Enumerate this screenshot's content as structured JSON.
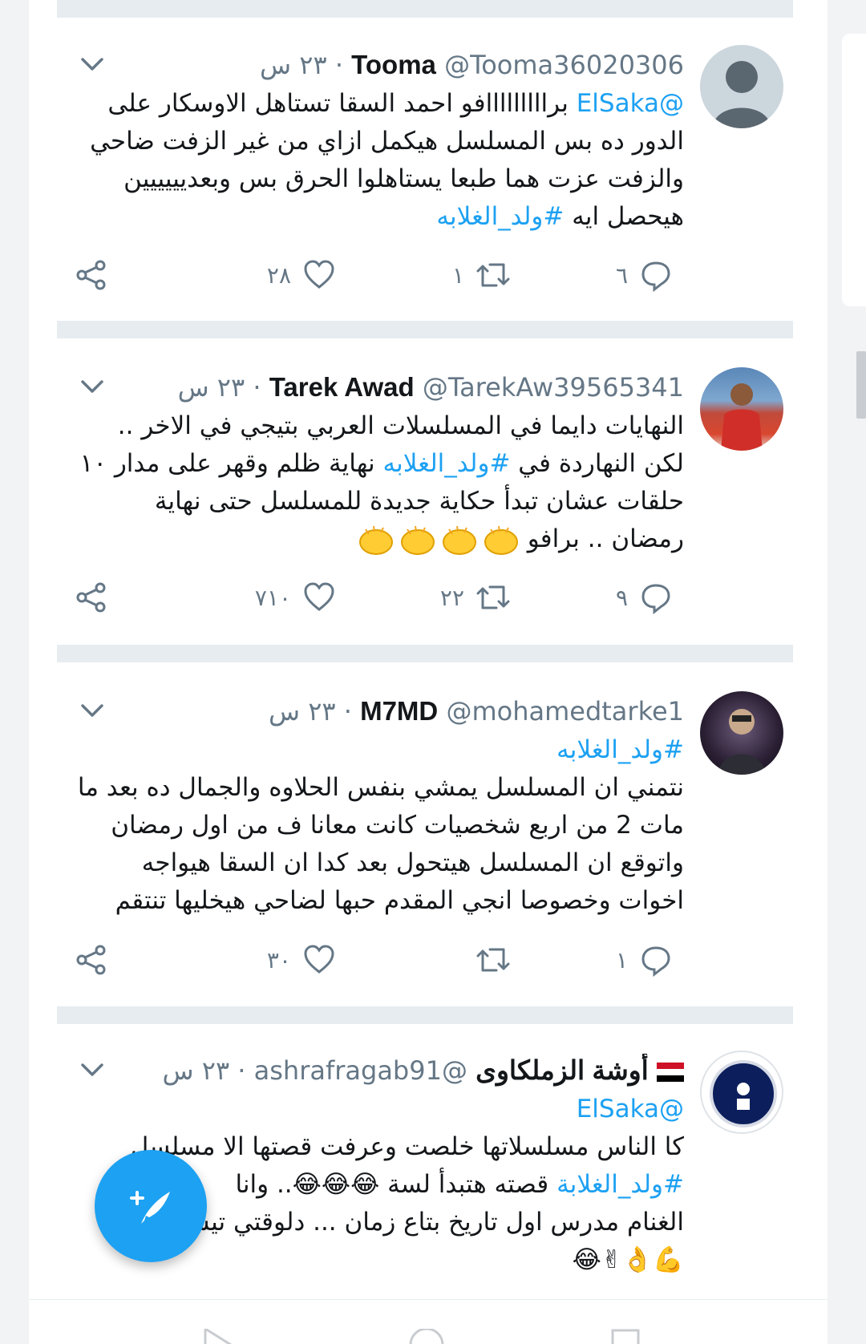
{
  "colors": {
    "accent": "#1da1f2",
    "text": "#14171a",
    "muted": "#657786",
    "separator": "#e6ecf0"
  },
  "tweets": [
    {
      "name": "Tooma",
      "handle": "@Tooma36020306",
      "time": "· ٢٣ س",
      "lines": [
        {
          "link": "@ElSaka",
          "text": " برااااااااافو احمد السقا تستاهل الاوسكار على"
        },
        {
          "text": "الدور ده بس المسلسل هيكمل ازاي من غير الزفت ضاحي"
        },
        {
          "text": "والزفت عزت هما طبعا يستاهلوا الحرق بس وبعديييييين"
        },
        {
          "text": "هيحصل ايه ",
          "link_after": "#ولد_الغلابه"
        }
      ],
      "replies": "٦",
      "retweets": "١",
      "likes": "٢٨"
    },
    {
      "name": "Tarek Awad",
      "handle": "@TarekAw39565341",
      "time": "· ٢٣ س",
      "lines": [
        {
          "text": "النهايات دايما في المسلسلات العربي بتيجي في الاخر .."
        },
        {
          "text": "لكن النهاردة في ",
          "link_after": "#ولد_الغلابه",
          "text_after": " نهاية ظلم وقهر على مدار ١٠"
        },
        {
          "text": "حلقات عشان تبدأ حكاية جديدة للمسلسل حتى نهاية"
        },
        {
          "text": "رمضان .. برافو "
        }
      ],
      "replies": "٩",
      "retweets": "٢٢",
      "likes": "٧١٠"
    },
    {
      "name": "M7MD",
      "handle": "@mohamedtarke1",
      "time": "· ٢٣ س",
      "lines": [
        {
          "link": "#ولد_الغلابه"
        },
        {
          "text": "نتمني ان المسلسل يمشي بنفس الحلاوه والجمال ده بعد ما"
        },
        {
          "text": "مات 2 من اربع شخصيات كانت معانا ف من اول رمضان"
        },
        {
          "text": "واتوقع ان المسلسل هيتحول بعد كدا ان السقا هيواجه"
        },
        {
          "text": "اخوات وخصوصا انجي المقدم حبها لضاحي هيخليها تنتقم"
        }
      ],
      "replies": "١",
      "retweets": "",
      "likes": "٣٠"
    },
    {
      "name": "أوشة الزملكاوى",
      "handle": "@ashrafragab91",
      "time": "· ٢٣ س",
      "lines": [
        {
          "link": "@ElSaka"
        },
        {
          "text": "كا الناس مسلسلاتها خلصت وعرفت قصتها الا مسلسل"
        },
        {
          "link": "#ولد_الغلابة",
          "text": " قصته هتبدأ لسة 😂😂😂.. وانا"
        },
        {
          "text": "الغنام مدرس اول تاريخ بتاع زمان ... دلوقتي تيس مال"
        },
        {
          "text": "💪👌✌😂"
        }
      ]
    }
  ]
}
